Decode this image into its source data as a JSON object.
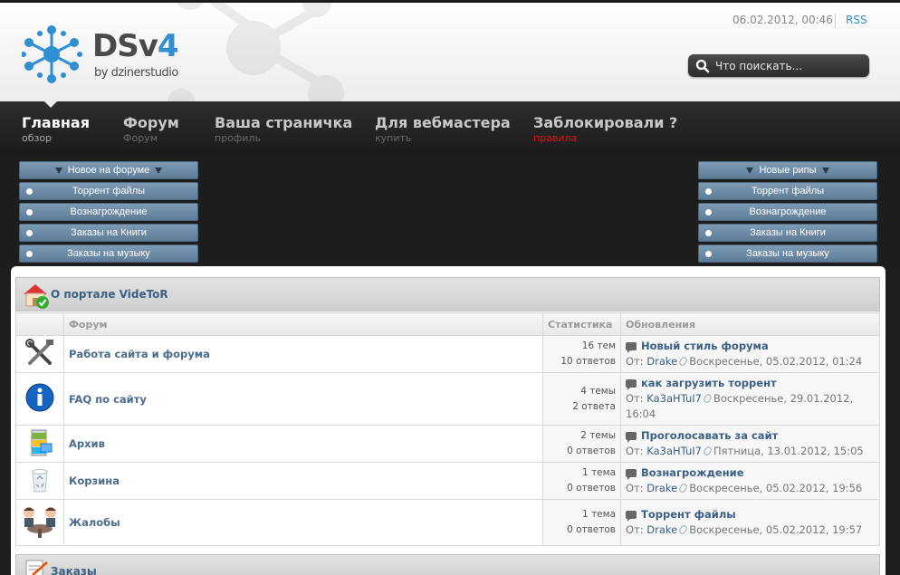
{
  "header": {
    "logo_main": "DSv",
    "logo_num": "4",
    "logo_sub": "by dzinerstudio",
    "date": "06.02.2012, 00:46",
    "rss": "RSS",
    "search_placeholder": "Что поискать..."
  },
  "nav": [
    {
      "title": "Главная",
      "sub": "обзор"
    },
    {
      "title": "Форум",
      "sub": "Форум"
    },
    {
      "title": "Ваша страничка",
      "sub": "профиль"
    },
    {
      "title": "Для вебмастера",
      "sub": "купить"
    },
    {
      "title": "Заблокировали ?",
      "sub": "правила"
    }
  ],
  "left_menu": {
    "head": "Новое на форуме",
    "items": [
      "Торрент файлы",
      "Вознагрождение",
      "Заказы на Книги",
      "Заказы на музыку"
    ]
  },
  "right_menu": {
    "head": "Новые рипы",
    "items": [
      "Торрент файлы",
      "Вознагрождение",
      "Заказы на Книги",
      "Заказы на музыку"
    ]
  },
  "category": {
    "title": "О портале VideToR",
    "col_forum": "Форум",
    "col_stats": "Статистика",
    "col_updates": "Обновления",
    "rows": [
      {
        "icon": "tools-icon",
        "name": "Работа сайта и форума",
        "topics": "16 тем",
        "replies": "10 ответов",
        "last_topic": "Новый стиль форума",
        "from": "От:",
        "user": "Drake",
        "date": "Воскресенье, 05.02.2012, 01:24"
      },
      {
        "icon": "info-icon",
        "name": "FAQ по сайту",
        "topics": "4 темы",
        "replies": "2 ответа",
        "last_topic": "как загрузить торрент",
        "from": "От:",
        "user": "Ka3aHTuI7",
        "date": "Воскресенье, 29.01.2012, 16:04"
      },
      {
        "icon": "archive-icon",
        "name": "Архив",
        "topics": "2 темы",
        "replies": "0 ответов",
        "last_topic": "Проголосавать за сайт",
        "from": "От:",
        "user": "Ka3aHTuI7",
        "date": "Пятница, 13.01.2012, 15:05"
      },
      {
        "icon": "recycle-bin-icon",
        "name": "Корзина",
        "topics": "1 тема",
        "replies": "0 ответов",
        "last_topic": "Вознагрождение",
        "from": "От:",
        "user": "Drake",
        "date": "Воскресенье, 05.02.2012, 19:56"
      },
      {
        "icon": "complaints-icon",
        "name": "Жалобы",
        "topics": "1 тема",
        "replies": "0 ответов",
        "last_topic": "Торрент файлы",
        "from": "От:",
        "user": "Drake",
        "date": "Воскресенье, 05.02.2012, 19:57"
      }
    ]
  },
  "category2": {
    "title": "Заказы"
  },
  "colors": {
    "accent": "#3c5f84",
    "menu_button": "#6d8aa6",
    "nav_bg": "#232323",
    "warning": "#e01010"
  }
}
